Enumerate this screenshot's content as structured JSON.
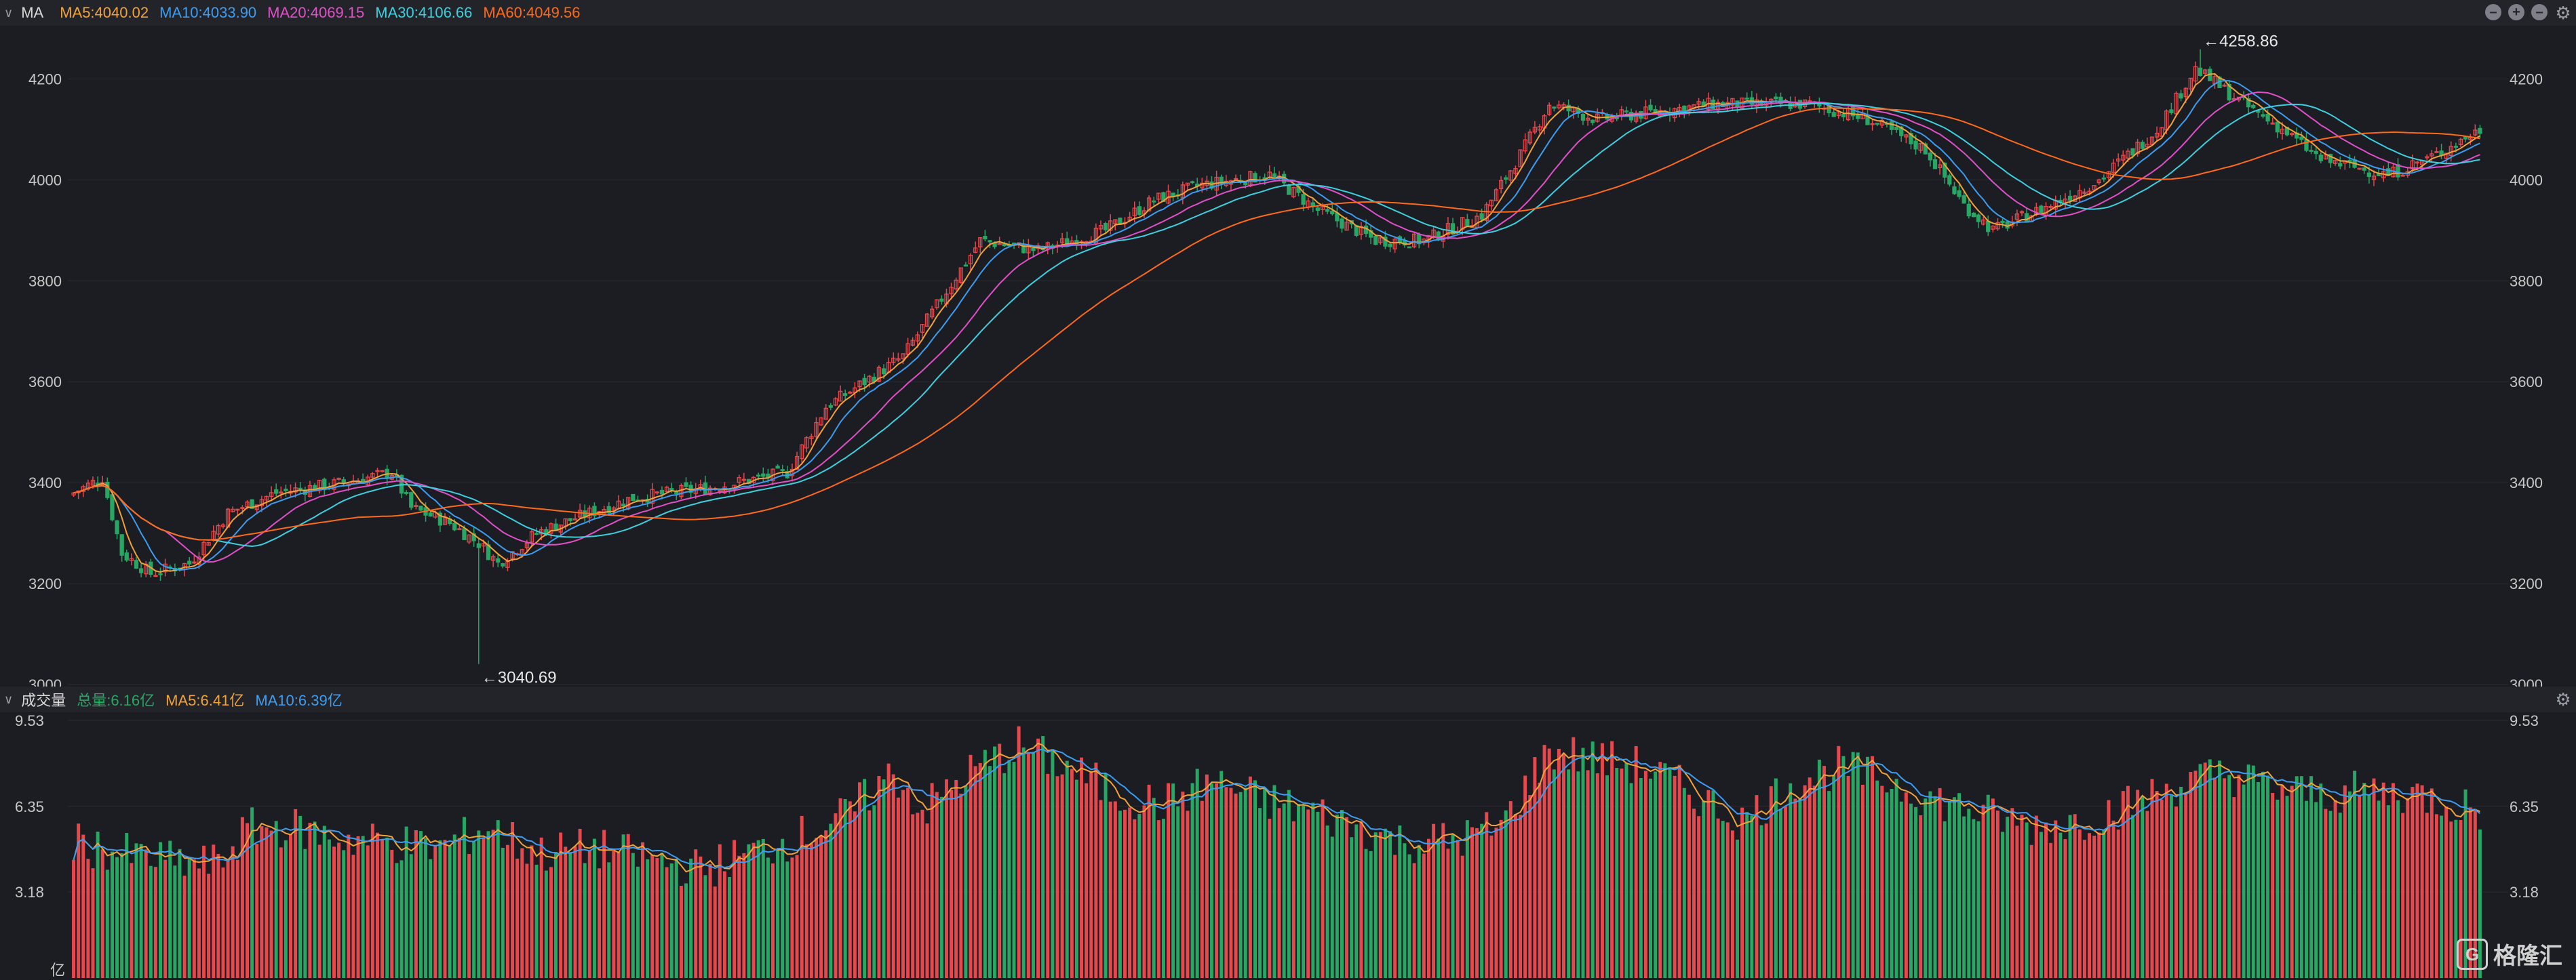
{
  "legend": {
    "indicator_label": "MA",
    "ma5": "MA5:4040.02",
    "ma10": "MA10:4033.90",
    "ma20": "MA20:4069.15",
    "ma30": "MA30:4106.66",
    "ma60": "MA60:4049.56"
  },
  "volume_legend": {
    "title": "成交量",
    "total": "总量:6.16亿",
    "ma5": "MA5:6.41亿",
    "ma10": "MA10:6.39亿"
  },
  "colors": {
    "up": "#e5484d",
    "down": "#27a664",
    "ma5": "#f2a23a",
    "ma10": "#3d9df0",
    "ma20": "#e050c8",
    "ma30": "#3cd0e0",
    "ma60": "#ff6a1a",
    "grid": "#2a2b31",
    "text": "#c8c8c8"
  },
  "watermark": "格隆汇",
  "chart_data": [
    {
      "type": "candlestick",
      "ylim": [
        3000,
        4300
      ],
      "y_ticks": [
        3000,
        3200,
        3400,
        3600,
        3800,
        4000,
        4200
      ],
      "y_tick_labels": [
        "3000",
        "3200",
        "3400",
        "3600",
        "3800",
        "4000",
        "4200"
      ],
      "grid": true,
      "count": 200,
      "anchors_close": [
        [
          0,
          3380
        ],
        [
          6,
          3410
        ],
        [
          10,
          3260
        ],
        [
          16,
          3220
        ],
        [
          24,
          3240
        ],
        [
          32,
          3340
        ],
        [
          42,
          3380
        ],
        [
          56,
          3400
        ],
        [
          66,
          3420
        ],
        [
          70,
          3350
        ],
        [
          78,
          3320
        ],
        [
          84,
          3280
        ],
        [
          88,
          3240
        ],
        [
          96,
          3300
        ],
        [
          104,
          3330
        ],
        [
          116,
          3370
        ],
        [
          124,
          3380
        ],
        [
          132,
          3390
        ],
        [
          148,
          3420
        ],
        [
          156,
          3550
        ],
        [
          172,
          3650
        ],
        [
          188,
          3880
        ],
        [
          200,
          3860
        ],
        [
          214,
          3900
        ],
        [
          224,
          3960
        ],
        [
          234,
          3990
        ],
        [
          248,
          4010
        ],
        [
          258,
          3940
        ],
        [
          270,
          3880
        ],
        [
          280,
          3880
        ],
        [
          292,
          3930
        ],
        [
          300,
          4050
        ],
        [
          306,
          4150
        ],
        [
          316,
          4120
        ],
        [
          324,
          4130
        ],
        [
          340,
          4150
        ],
        [
          360,
          4150
        ],
        [
          372,
          4120
        ],
        [
          384,
          4060
        ],
        [
          392,
          3950
        ],
        [
          398,
          3900
        ],
        [
          410,
          3950
        ],
        [
          420,
          4000
        ],
        [
          432,
          4100
        ],
        [
          440,
          4220
        ],
        [
          450,
          4150
        ],
        [
          458,
          4100
        ],
        [
          466,
          4040
        ],
        [
          480,
          4010
        ],
        [
          490,
          4050
        ],
        [
          499,
          4100
        ]
      ],
      "annotations": [
        {
          "text": "←4258.86",
          "x_index": 441,
          "value": 4258.86,
          "position": "above"
        },
        {
          "text": "←3040.69",
          "x_index": 84,
          "value": 3040.69,
          "position": "below"
        }
      ],
      "moving_averages": [
        {
          "name": "MA5",
          "period": 5,
          "last": 4040.02
        },
        {
          "name": "MA10",
          "period": 10,
          "last": 4033.9
        },
        {
          "name": "MA20",
          "period": 20,
          "last": 4069.15
        },
        {
          "name": "MA30",
          "period": 30,
          "last": 4106.66
        },
        {
          "name": "MA60",
          "period": 60,
          "last": 4049.56
        }
      ]
    },
    {
      "type": "bar",
      "unit": "亿",
      "ylim": [
        0,
        9.53
      ],
      "y_ticks": [
        3.18,
        6.35,
        9.53
      ],
      "y_tick_labels": [
        "3.18",
        "6.35",
        "9.53"
      ],
      "unit_label": "亿",
      "anchors": [
        [
          0,
          5.0
        ],
        [
          10,
          4.6
        ],
        [
          20,
          4.3
        ],
        [
          30,
          4.2
        ],
        [
          36,
          5.5
        ],
        [
          44,
          5.6
        ],
        [
          54,
          5.2
        ],
        [
          66,
          5.0
        ],
        [
          76,
          4.8
        ],
        [
          86,
          5.6
        ],
        [
          96,
          4.6
        ],
        [
          108,
          4.8
        ],
        [
          120,
          4.4
        ],
        [
          130,
          4.0
        ],
        [
          140,
          4.6
        ],
        [
          150,
          5.2
        ],
        [
          160,
          6.0
        ],
        [
          170,
          7.6
        ],
        [
          176,
          6.2
        ],
        [
          186,
          7.6
        ],
        [
          196,
          8.6
        ],
        [
          206,
          7.8
        ],
        [
          216,
          6.8
        ],
        [
          226,
          6.4
        ],
        [
          236,
          7.3
        ],
        [
          246,
          6.6
        ],
        [
          256,
          6.2
        ],
        [
          266,
          5.6
        ],
        [
          276,
          5.0
        ],
        [
          286,
          5.1
        ],
        [
          296,
          5.6
        ],
        [
          306,
          8.4
        ],
        [
          316,
          8.1
        ],
        [
          326,
          7.8
        ],
        [
          336,
          6.8
        ],
        [
          346,
          5.8
        ],
        [
          356,
          7.2
        ],
        [
          366,
          7.8
        ],
        [
          376,
          7.3
        ],
        [
          386,
          6.6
        ],
        [
          396,
          6.1
        ],
        [
          406,
          5.6
        ],
        [
          416,
          5.8
        ],
        [
          426,
          6.4
        ],
        [
          436,
          7.1
        ],
        [
          446,
          7.6
        ],
        [
          456,
          7.0
        ],
        [
          466,
          6.8
        ],
        [
          476,
          6.9
        ],
        [
          486,
          6.8
        ],
        [
          499,
          6.2
        ]
      ]
    }
  ]
}
